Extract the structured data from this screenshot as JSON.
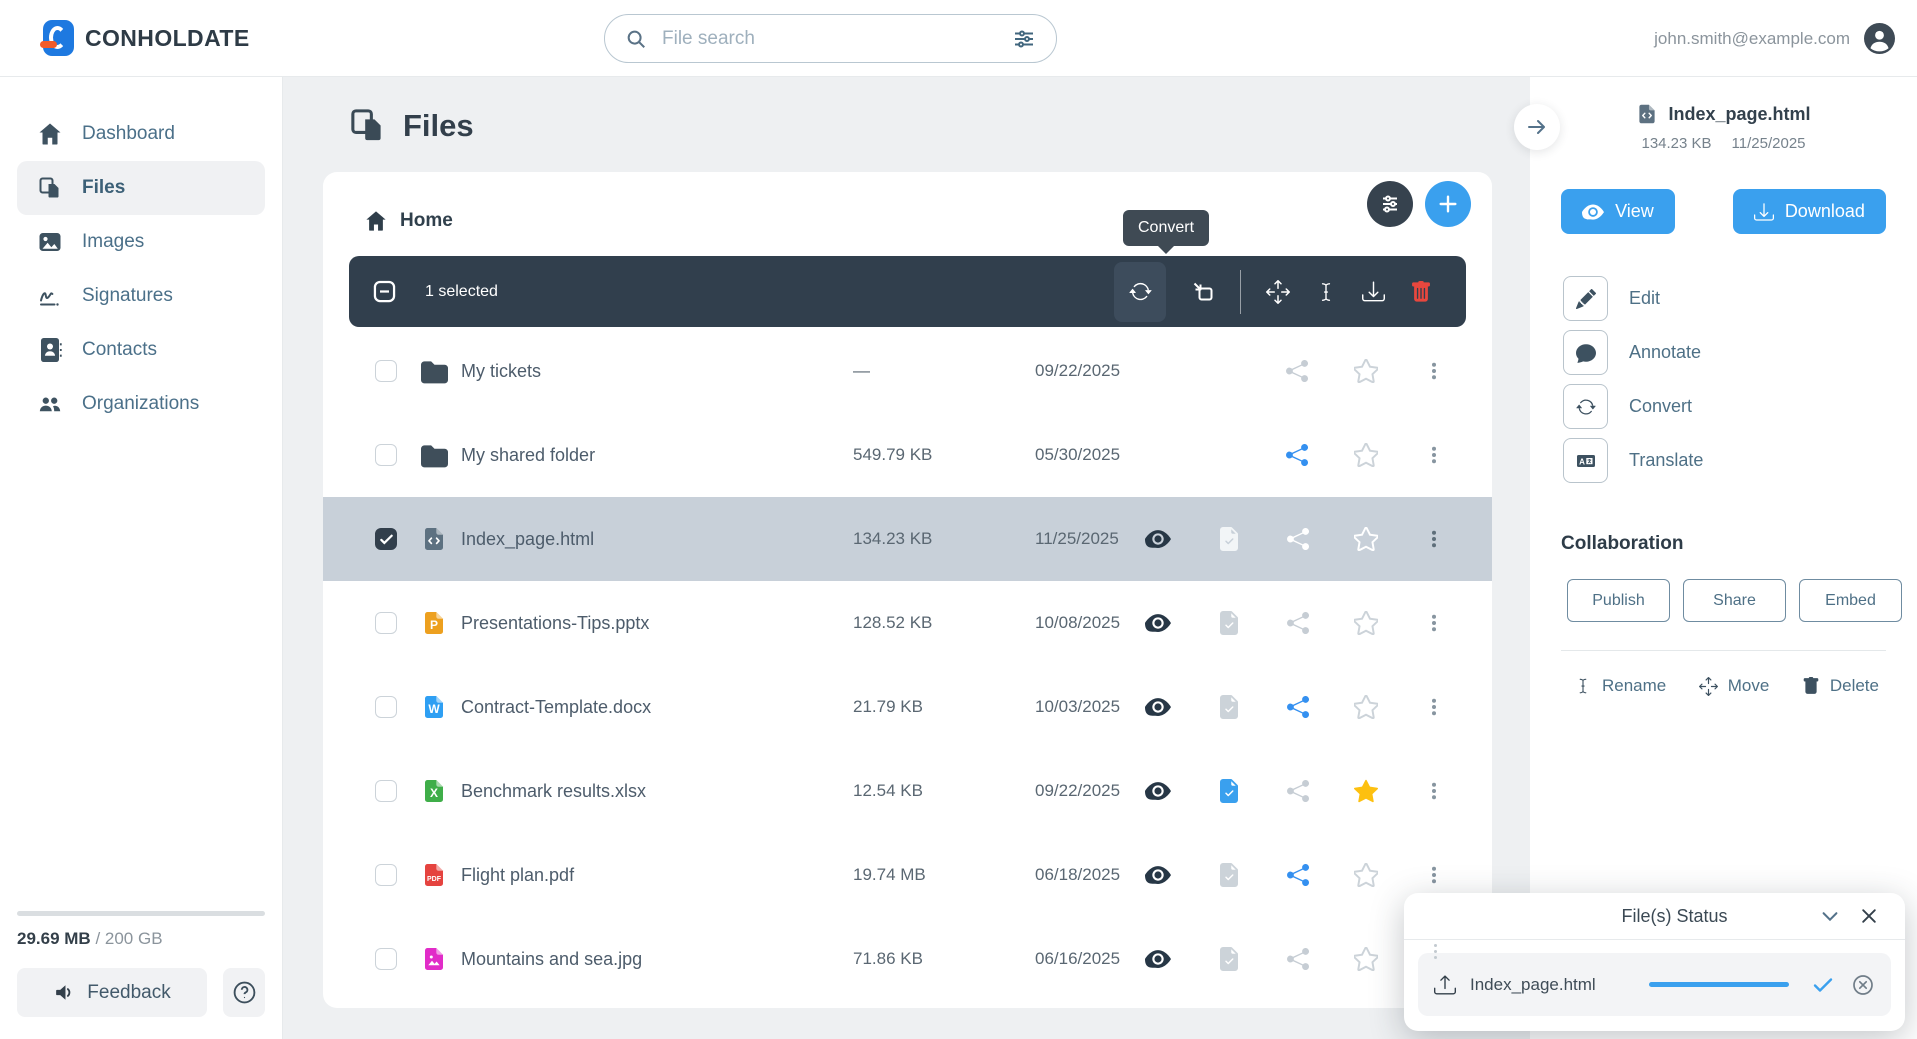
{
  "topbar": {
    "brand": "CONHOLDATE",
    "search_placeholder": "File search",
    "user_email": "john.smith@example.com"
  },
  "sidebar": {
    "items": [
      {
        "label": "Dashboard",
        "active": false
      },
      {
        "label": "Files",
        "active": true
      },
      {
        "label": "Images",
        "active": false
      },
      {
        "label": "Signatures",
        "active": false
      },
      {
        "label": "Contacts",
        "active": false
      },
      {
        "label": "Organizations",
        "active": false
      }
    ],
    "storage_used": "29.69 MB",
    "storage_total": "/ 200 GB",
    "feedback_label": "Feedback"
  },
  "main": {
    "title": "Files",
    "breadcrumb": "Home",
    "selection_toolbar": {
      "selected_text": "1 selected",
      "tooltip": "Convert"
    },
    "files": {
      "rows": [
        {
          "name": "My tickets",
          "type": "folder",
          "size": "—",
          "date": "09/22/2025",
          "selected": false,
          "shared": false,
          "starred": false
        },
        {
          "name": "My shared folder",
          "type": "folder",
          "size": "549.79 KB",
          "date": "05/30/2025",
          "selected": false,
          "shared": true,
          "starred": false
        },
        {
          "name": "Index_page.html",
          "type": "html",
          "size": "134.23 KB",
          "date": "11/25/2025",
          "selected": true,
          "shared": false,
          "starred": false
        },
        {
          "name": "Presentations-Tips.pptx",
          "type": "pptx",
          "badge": "P",
          "size": "128.52 KB",
          "date": "10/08/2025",
          "selected": false,
          "shared": false,
          "starred": false
        },
        {
          "name": "Contract-Template.docx",
          "type": "docx",
          "badge": "W",
          "size": "21.79 KB",
          "date": "10/03/2025",
          "selected": false,
          "shared": true,
          "starred": false
        },
        {
          "name": "Benchmark results.xlsx",
          "type": "xlsx",
          "badge": "X",
          "size": "12.54 KB",
          "date": "09/22/2025",
          "selected": false,
          "converted": true,
          "shared": false,
          "starred": true
        },
        {
          "name": "Flight plan.pdf",
          "type": "pdf",
          "badge": "PDF",
          "size": "19.74 MB",
          "date": "06/18/2025",
          "selected": false,
          "shared": true,
          "starred": false
        },
        {
          "name": "Mountains and sea.jpg",
          "type": "jpg",
          "size": "71.86 KB",
          "date": "06/16/2025",
          "selected": false,
          "shared": false,
          "starred": false
        }
      ]
    }
  },
  "details": {
    "file_name": "Index_page.html",
    "file_size": "134.23 KB",
    "file_date": "11/25/2025",
    "view_label": "View",
    "download_label": "Download",
    "actions": [
      {
        "label": "Edit"
      },
      {
        "label": "Annotate"
      },
      {
        "label": "Convert"
      },
      {
        "label": "Translate"
      }
    ],
    "collaboration_title": "Collaboration",
    "collab_buttons": [
      {
        "label": "Publish"
      },
      {
        "label": "Share"
      },
      {
        "label": "Embed"
      }
    ],
    "footer_actions": [
      {
        "label": "Rename"
      },
      {
        "label": "Move"
      },
      {
        "label": "Delete"
      }
    ]
  },
  "status_panel": {
    "title": "File(s) Status",
    "file_name": "Index_page.html",
    "progress_percent": 100
  },
  "colors": {
    "accent_blue": "#3aa0ee",
    "toolbar_dark": "#313f4d",
    "selected_row": "#c8d0d9",
    "star_yellow": "#fdc010",
    "share_blue": "#3490f0",
    "delete_red": "#e8473e",
    "pptx_orange": "#eda01f",
    "docx_blue": "#2e9ff3",
    "xlsx_green": "#3fae49",
    "pdf_red": "#e5433f",
    "jpg_magenta": "#e12cc8",
    "html_slate": "#5d7181"
  }
}
